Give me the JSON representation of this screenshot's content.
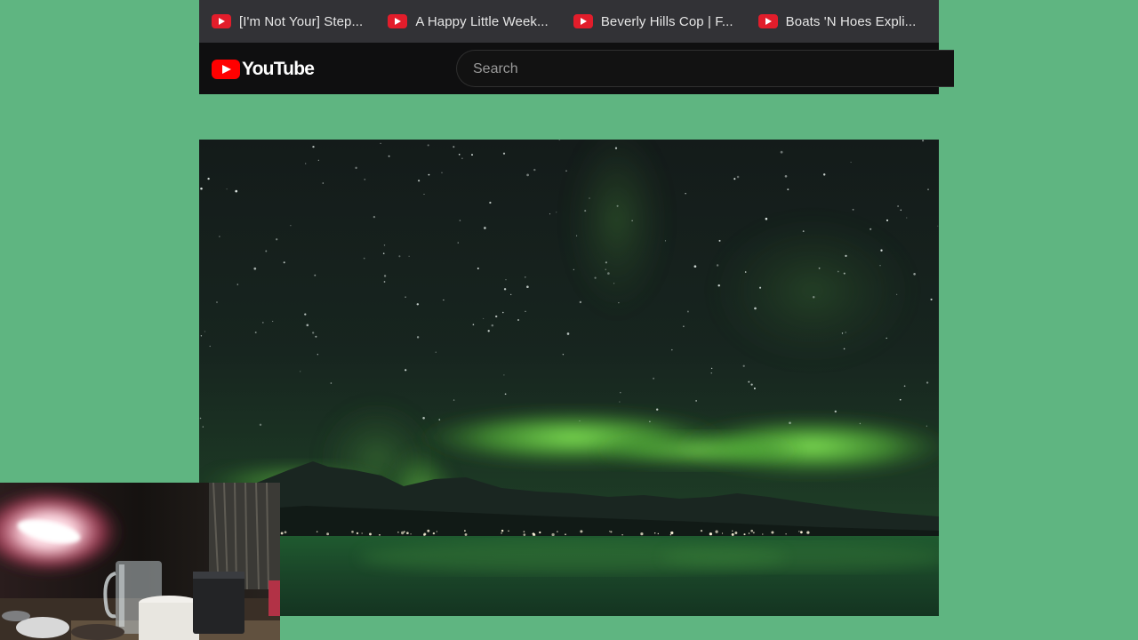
{
  "bookmarks": [
    {
      "icon": "youtube-icon",
      "label": "[I'm Not Your] Step..."
    },
    {
      "icon": "youtube-icon",
      "label": "A Happy Little Week..."
    },
    {
      "icon": "youtube-icon",
      "label": "Beverly Hills Cop | F..."
    },
    {
      "icon": "youtube-icon",
      "label": "Boats 'N Hoes Expli..."
    }
  ],
  "header": {
    "logo_text": "YouTube",
    "search_placeholder": "Search"
  },
  "colors": {
    "page_background": "#5fb581",
    "bookmarks_bar": "#323236",
    "header_background": "#0f0f10",
    "youtube_red": "#ff0000",
    "aurora_green": "#7be04a"
  },
  "video": {
    "scene": "aurora-over-fjord"
  },
  "webcam": {
    "scene": "desk-with-lamp-and-mugs"
  }
}
